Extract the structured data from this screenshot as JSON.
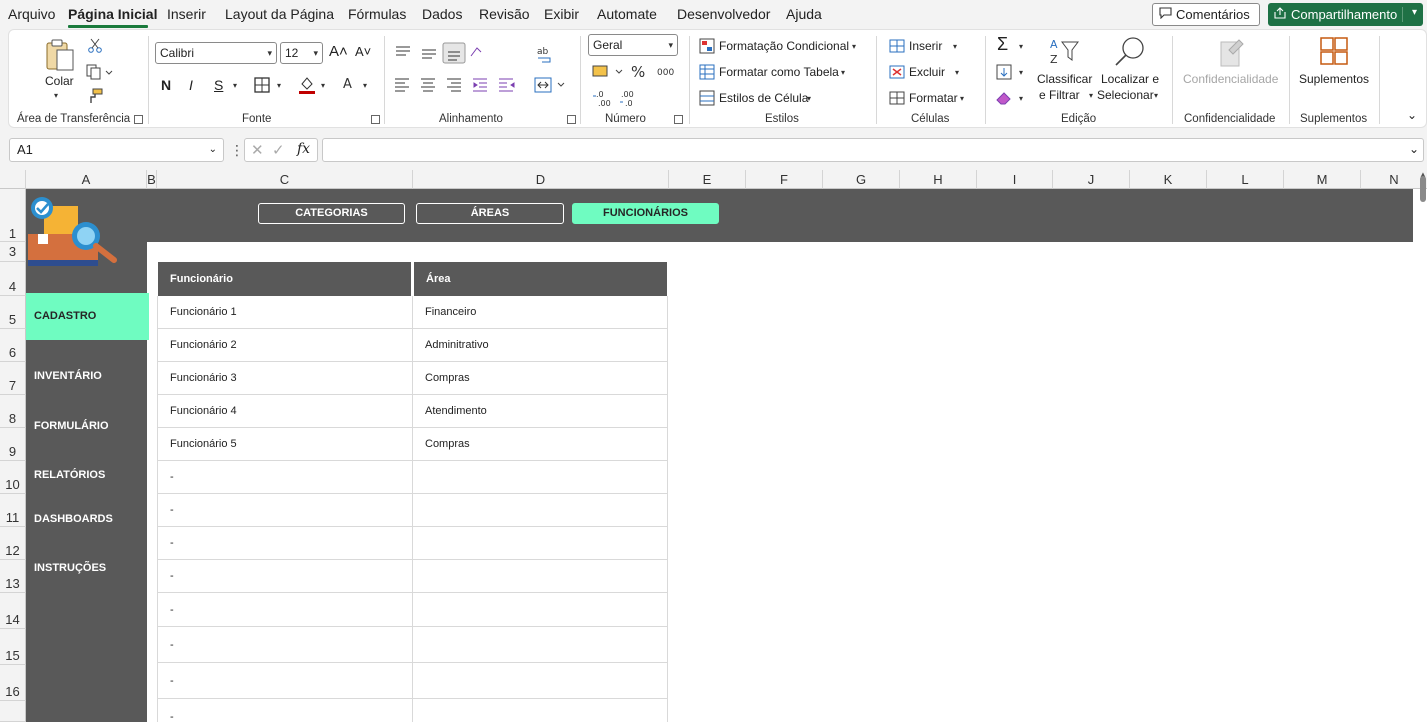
{
  "menu": {
    "items": [
      "Arquivo",
      "Página Inicial",
      "Inserir",
      "Layout da Página",
      "Fórmulas",
      "Dados",
      "Revisão",
      "Exibir",
      "Automate",
      "Desenvolvedor",
      "Ajuda"
    ],
    "comments_label": "Comentários",
    "share_label": "Compartilhamento"
  },
  "ribbon": {
    "clipboard": {
      "paste_label": "Colar",
      "group_label": "Área de Transferência"
    },
    "font": {
      "font_name": "Calibri",
      "font_size": "12",
      "bold": "N",
      "italic": "I",
      "underline": "S",
      "group_label": "Fonte"
    },
    "alignment": {
      "group_label": "Alinhamento"
    },
    "number": {
      "format": "Geral",
      "group_label": "Número"
    },
    "styles": {
      "conditional": "Formatação Condicional",
      "as_table": "Formatar como Tabela",
      "cell_styles": "Estilos de Célula",
      "group_label": "Estilos"
    },
    "cells": {
      "insert": "Inserir",
      "delete": "Excluir",
      "format": "Formatar",
      "group_label": "Células"
    },
    "editing": {
      "sort_line1": "Classificar",
      "sort_line2": "e Filtrar",
      "find_line1": "Localizar e",
      "find_line2": "Selecionar",
      "group_label": "Edição"
    },
    "sensitivity": {
      "label": "Confidencialidade",
      "group_label": "Confidencialidade"
    },
    "addins": {
      "label": "Suplementos",
      "group_label": "Suplementos"
    }
  },
  "formula_bar": {
    "name_box": "A1",
    "formula": ""
  },
  "columns": [
    "A",
    "B",
    "C",
    "D",
    "E",
    "F",
    "G",
    "H",
    "I",
    "J",
    "K",
    "L",
    "M",
    "N"
  ],
  "rows": [
    "1",
    "3",
    "4",
    "5",
    "6",
    "7",
    "8",
    "9",
    "10",
    "11",
    "12",
    "13",
    "14",
    "15",
    "16"
  ],
  "top_tabs": [
    {
      "label": "CATEGORIAS",
      "active": false
    },
    {
      "label": "ÁREAS",
      "active": false
    },
    {
      "label": "FUNCIONÁRIOS",
      "active": true
    }
  ],
  "sidebar": [
    {
      "label": "CADASTRO",
      "active": true
    },
    {
      "label": "INVENTÁRIO",
      "active": false
    },
    {
      "label": "FORMULÁRIO",
      "active": false
    },
    {
      "label": "RELATÓRIOS",
      "active": false
    },
    {
      "label": "DASHBOARDS",
      "active": false
    },
    {
      "label": "INSTRUÇÕES",
      "active": false
    }
  ],
  "table": {
    "headers": [
      "Funcionário",
      "Área"
    ],
    "rows": [
      [
        "Funcionário 1",
        "Financeiro"
      ],
      [
        "Funcionário 2",
        "Adminitrativo"
      ],
      [
        "Funcionário 3",
        "Compras"
      ],
      [
        "Funcionário 4",
        "Atendimento"
      ],
      [
        "Funcionário 5",
        "Compras"
      ],
      [
        "-",
        ""
      ],
      [
        "-",
        ""
      ],
      [
        "-",
        ""
      ],
      [
        "-",
        ""
      ],
      [
        "-",
        ""
      ],
      [
        "-",
        ""
      ],
      [
        "-",
        ""
      ],
      [
        "-",
        ""
      ]
    ]
  },
  "colors": {
    "accent": "#6ffcc1",
    "dark": "#595959",
    "share_green": "#1e7145"
  }
}
